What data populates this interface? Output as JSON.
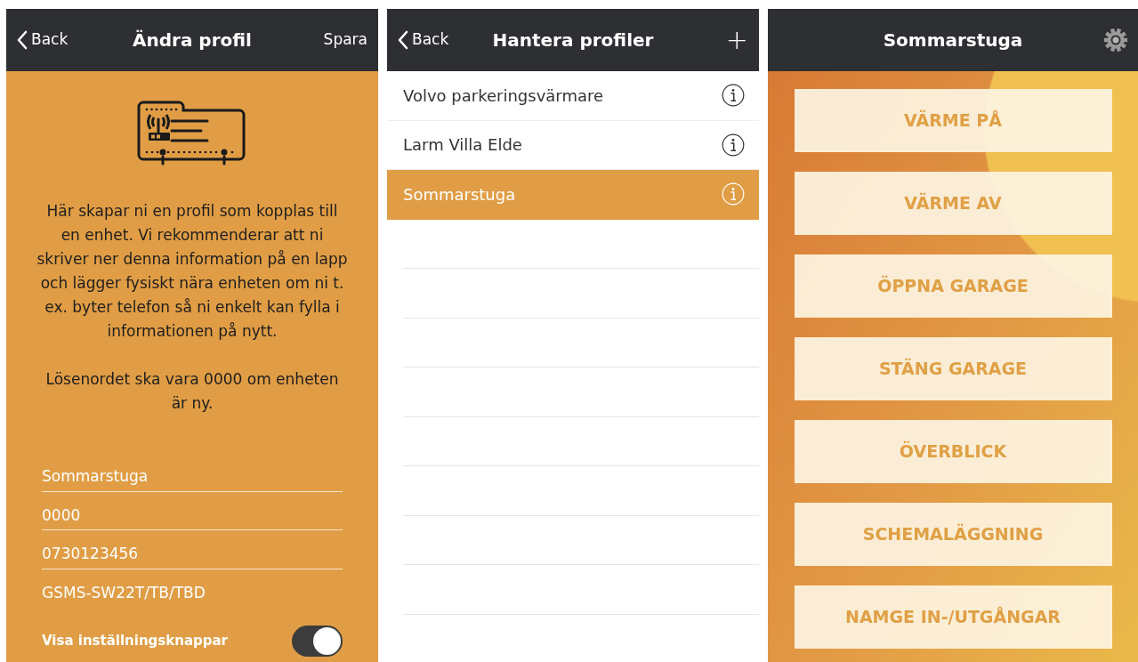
{
  "edit_profile": {
    "nav": {
      "back": "Back",
      "title": "Ändra profil",
      "action": "Spara"
    },
    "paragraphs": [
      "Här skapar ni en profil som kopplas till en enhet. Vi rekommenderar att ni skriver ner denna information på en lapp och lägger fysiskt nära enheten om ni t. ex. byter telefon så ni enkelt kan fylla i informationen på nytt.",
      "Lösenordet ska vara 0000 om enheten är ny."
    ],
    "fields": [
      {
        "kind": "input",
        "value": "Sommarstuga"
      },
      {
        "kind": "input",
        "value": "0000"
      },
      {
        "kind": "input",
        "value": "0730123456"
      },
      {
        "kind": "text",
        "value": "GSMS-SW22T/TB/TBD"
      }
    ],
    "toggle": {
      "label": "Visa inställningsknappar",
      "on": true
    }
  },
  "manage_profiles": {
    "nav": {
      "back": "Back",
      "title": "Hantera profiler",
      "action": "+"
    },
    "profiles": [
      {
        "name": "Volvo parkeringsvärmare",
        "selected": false
      },
      {
        "name": "Larm Villa Elde",
        "selected": false
      },
      {
        "name": "Sommarstuga",
        "selected": true
      }
    ]
  },
  "device": {
    "nav": {
      "title": "Sommarstuga"
    },
    "buttons": [
      "VÄRME PÅ",
      "VÄRME AV",
      "ÖPPNA GARAGE",
      "STÄNG GARAGE",
      "ÖVERBLICK",
      "SCHEMALÄGGNING",
      "NAMGE IN-/UTGÅNGAR"
    ]
  }
}
